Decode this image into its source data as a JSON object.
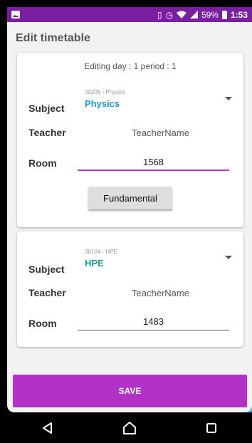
{
  "status_bar": {
    "battery": "59%",
    "time": "1:53",
    "icons": [
      "app-icon",
      "image-icon",
      "vibrate-icon",
      "alarm-icon",
      "wifi-icon",
      "signal-icon",
      "battery-icon"
    ]
  },
  "header": {
    "title": "Edit timetable"
  },
  "card1": {
    "editing_text": "Editing day : 1 period : 1",
    "subject_label": "Subject",
    "subject_code": "30206 - Physics",
    "subject_name": "Physics",
    "subject_color": "#1a9bd7",
    "teacher_label": "Teacher",
    "teacher_value": "TeacherName",
    "room_label": "Room",
    "room_value": "1568",
    "button_label": "Fundamental"
  },
  "card2": {
    "subject_label": "Subject",
    "subject_code": "30104 - HPE",
    "subject_name": "HPE",
    "subject_color": "#1a9e8a",
    "teacher_label": "Teacher",
    "teacher_value": "TeacherName",
    "room_label": "Room",
    "room_value": "1483"
  },
  "save_label": "SAVE",
  "nav": {
    "icons": [
      "back-icon",
      "home-icon",
      "recents-icon"
    ]
  },
  "colors": {
    "accent": "#b232c8",
    "status_bar": "#7b1fa2"
  }
}
